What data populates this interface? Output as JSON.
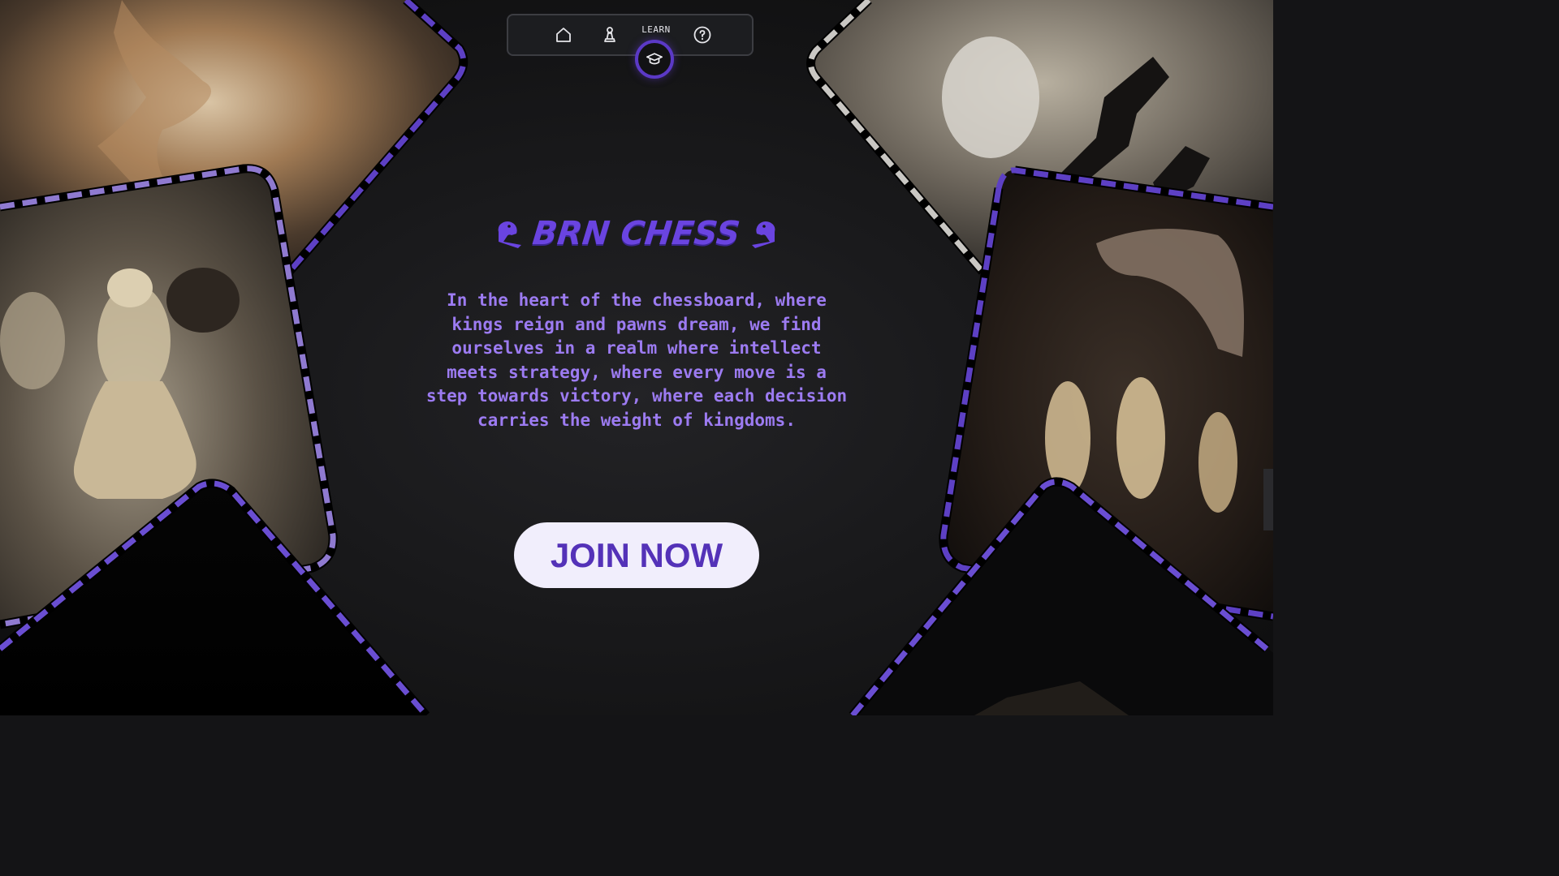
{
  "nav": {
    "items": [
      {
        "icon": "home-icon"
      },
      {
        "icon": "pawn-icon"
      },
      {
        "icon": "graduation-cap-icon",
        "label": "LEARN",
        "active": true
      },
      {
        "icon": "help-icon"
      }
    ]
  },
  "hero": {
    "title": "BRN CHESS",
    "tagline": "In the heart of the chessboard, where kings reign and pawns dream, we find ourselves in a realm where intellect meets strategy, where every move is a step towards victory, where each decision carries the weight of kingdoms.",
    "cta_label": "JOIN NOW"
  },
  "colors": {
    "accent": "#5b39c6",
    "title": "#6a44e0",
    "tagline": "#9c7bf1",
    "button_bg": "#f1eefc",
    "button_text": "#5432b8"
  }
}
